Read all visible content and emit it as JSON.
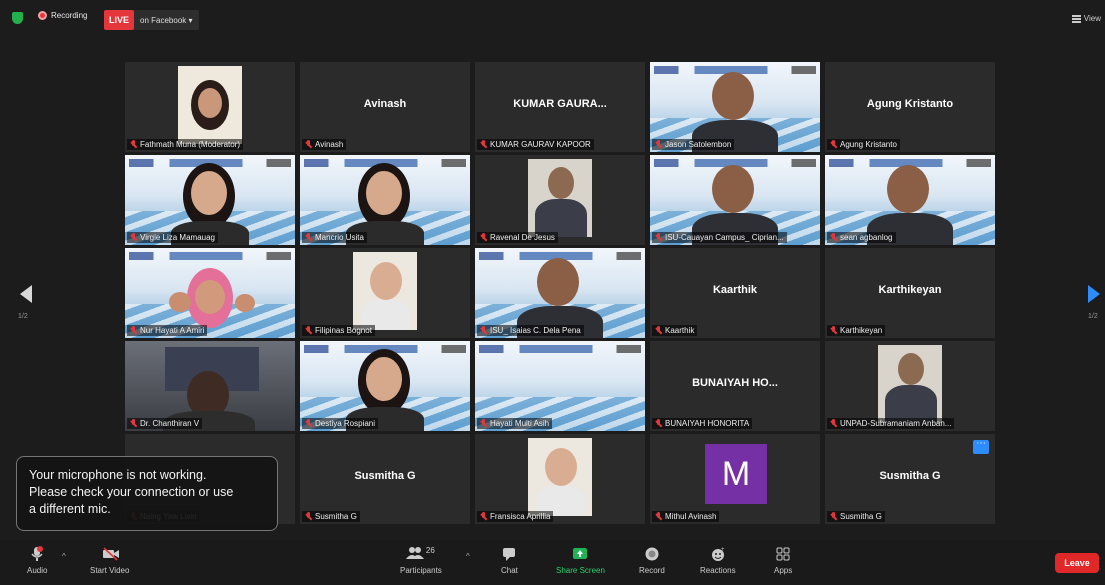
{
  "topbar": {
    "recording_label": "Recording",
    "live_badge": "LIVE",
    "live_target": "on Facebook ▾",
    "view_label": "View"
  },
  "pagination": {
    "left": "1/2",
    "right": "1/2"
  },
  "tiles": [
    {
      "label": "Fathmath Muna (Moderator)",
      "big": "",
      "kind": "photo-hijab"
    },
    {
      "label": "Avinash",
      "big": "Avinash",
      "kind": "name"
    },
    {
      "label": "KUMAR GAURAV KAPOOR",
      "big": "KUMAR GAURA...",
      "kind": "name"
    },
    {
      "label": "Jason Satolembon",
      "big": "",
      "kind": "slide-man",
      "active": true
    },
    {
      "label": "Agung Kristanto",
      "big": "Agung Kristanto",
      "kind": "name"
    },
    {
      "label": "Virgie Liza Mamauag",
      "big": "",
      "kind": "slide-woman"
    },
    {
      "label": "Mancrio Usita",
      "big": "",
      "kind": "slide-woman"
    },
    {
      "label": "Ravenal De Jesus",
      "big": "",
      "kind": "photo-suit"
    },
    {
      "label": "ISU-Cauayan Campus_ Ciprian...",
      "big": "",
      "kind": "slide-man"
    },
    {
      "label": "sean agbanlog",
      "big": "",
      "kind": "slide-man"
    },
    {
      "label": "Nur Hayati A Amiri",
      "big": "",
      "kind": "slide-hijab"
    },
    {
      "label": "Filipinas Bognot",
      "big": "",
      "kind": "photo-woman"
    },
    {
      "label": "ISU_ Isaias C. Dela Pena",
      "big": "",
      "kind": "slide-man"
    },
    {
      "label": "Kaarthik",
      "big": "Kaarthik",
      "kind": "name"
    },
    {
      "label": "Karthikeyan",
      "big": "Karthikeyan",
      "kind": "name"
    },
    {
      "label": "Dr. Chanthiran V",
      "big": "",
      "kind": "room"
    },
    {
      "label": "Destiya Rospiani",
      "big": "",
      "kind": "slide-woman"
    },
    {
      "label": "Hayati Multi Asih",
      "big": "",
      "kind": "slide"
    },
    {
      "label": "BUNAIYAH HONORITA",
      "big": "BUNAIYAH HO...",
      "kind": "name"
    },
    {
      "label": "UNPAD-Subramaniam Anban...",
      "big": "",
      "kind": "photo-suit"
    },
    {
      "label": "Naing Yaw Lwin",
      "big": "",
      "kind": "name"
    },
    {
      "label": "Susmitha G",
      "big": "Susmitha G",
      "kind": "name"
    },
    {
      "label": "Fransisca Aprillia",
      "big": "",
      "kind": "photo-woman"
    },
    {
      "label": "Mithul Avinash",
      "big": "",
      "kind": "avatar",
      "avatar": "M"
    },
    {
      "label": "Susmitha G",
      "big": "Susmitha G",
      "kind": "name-blue"
    }
  ],
  "toast": {
    "line1": "Your microphone is not working.",
    "line2": "Please check your connection or use",
    "line3": "a different mic."
  },
  "toolbar": {
    "audio": "Audio",
    "start_video": "Start Video",
    "participants": "Participants",
    "participants_count": "26",
    "chat": "Chat",
    "share_screen": "Share Screen",
    "record": "Record",
    "reactions": "Reactions",
    "apps": "Apps",
    "leave": "Leave"
  },
  "colors": {
    "accent": "#2d8cff",
    "live_red": "#e4363b",
    "active_outline": "#c6e23a",
    "share_green": "#2fd06a"
  }
}
